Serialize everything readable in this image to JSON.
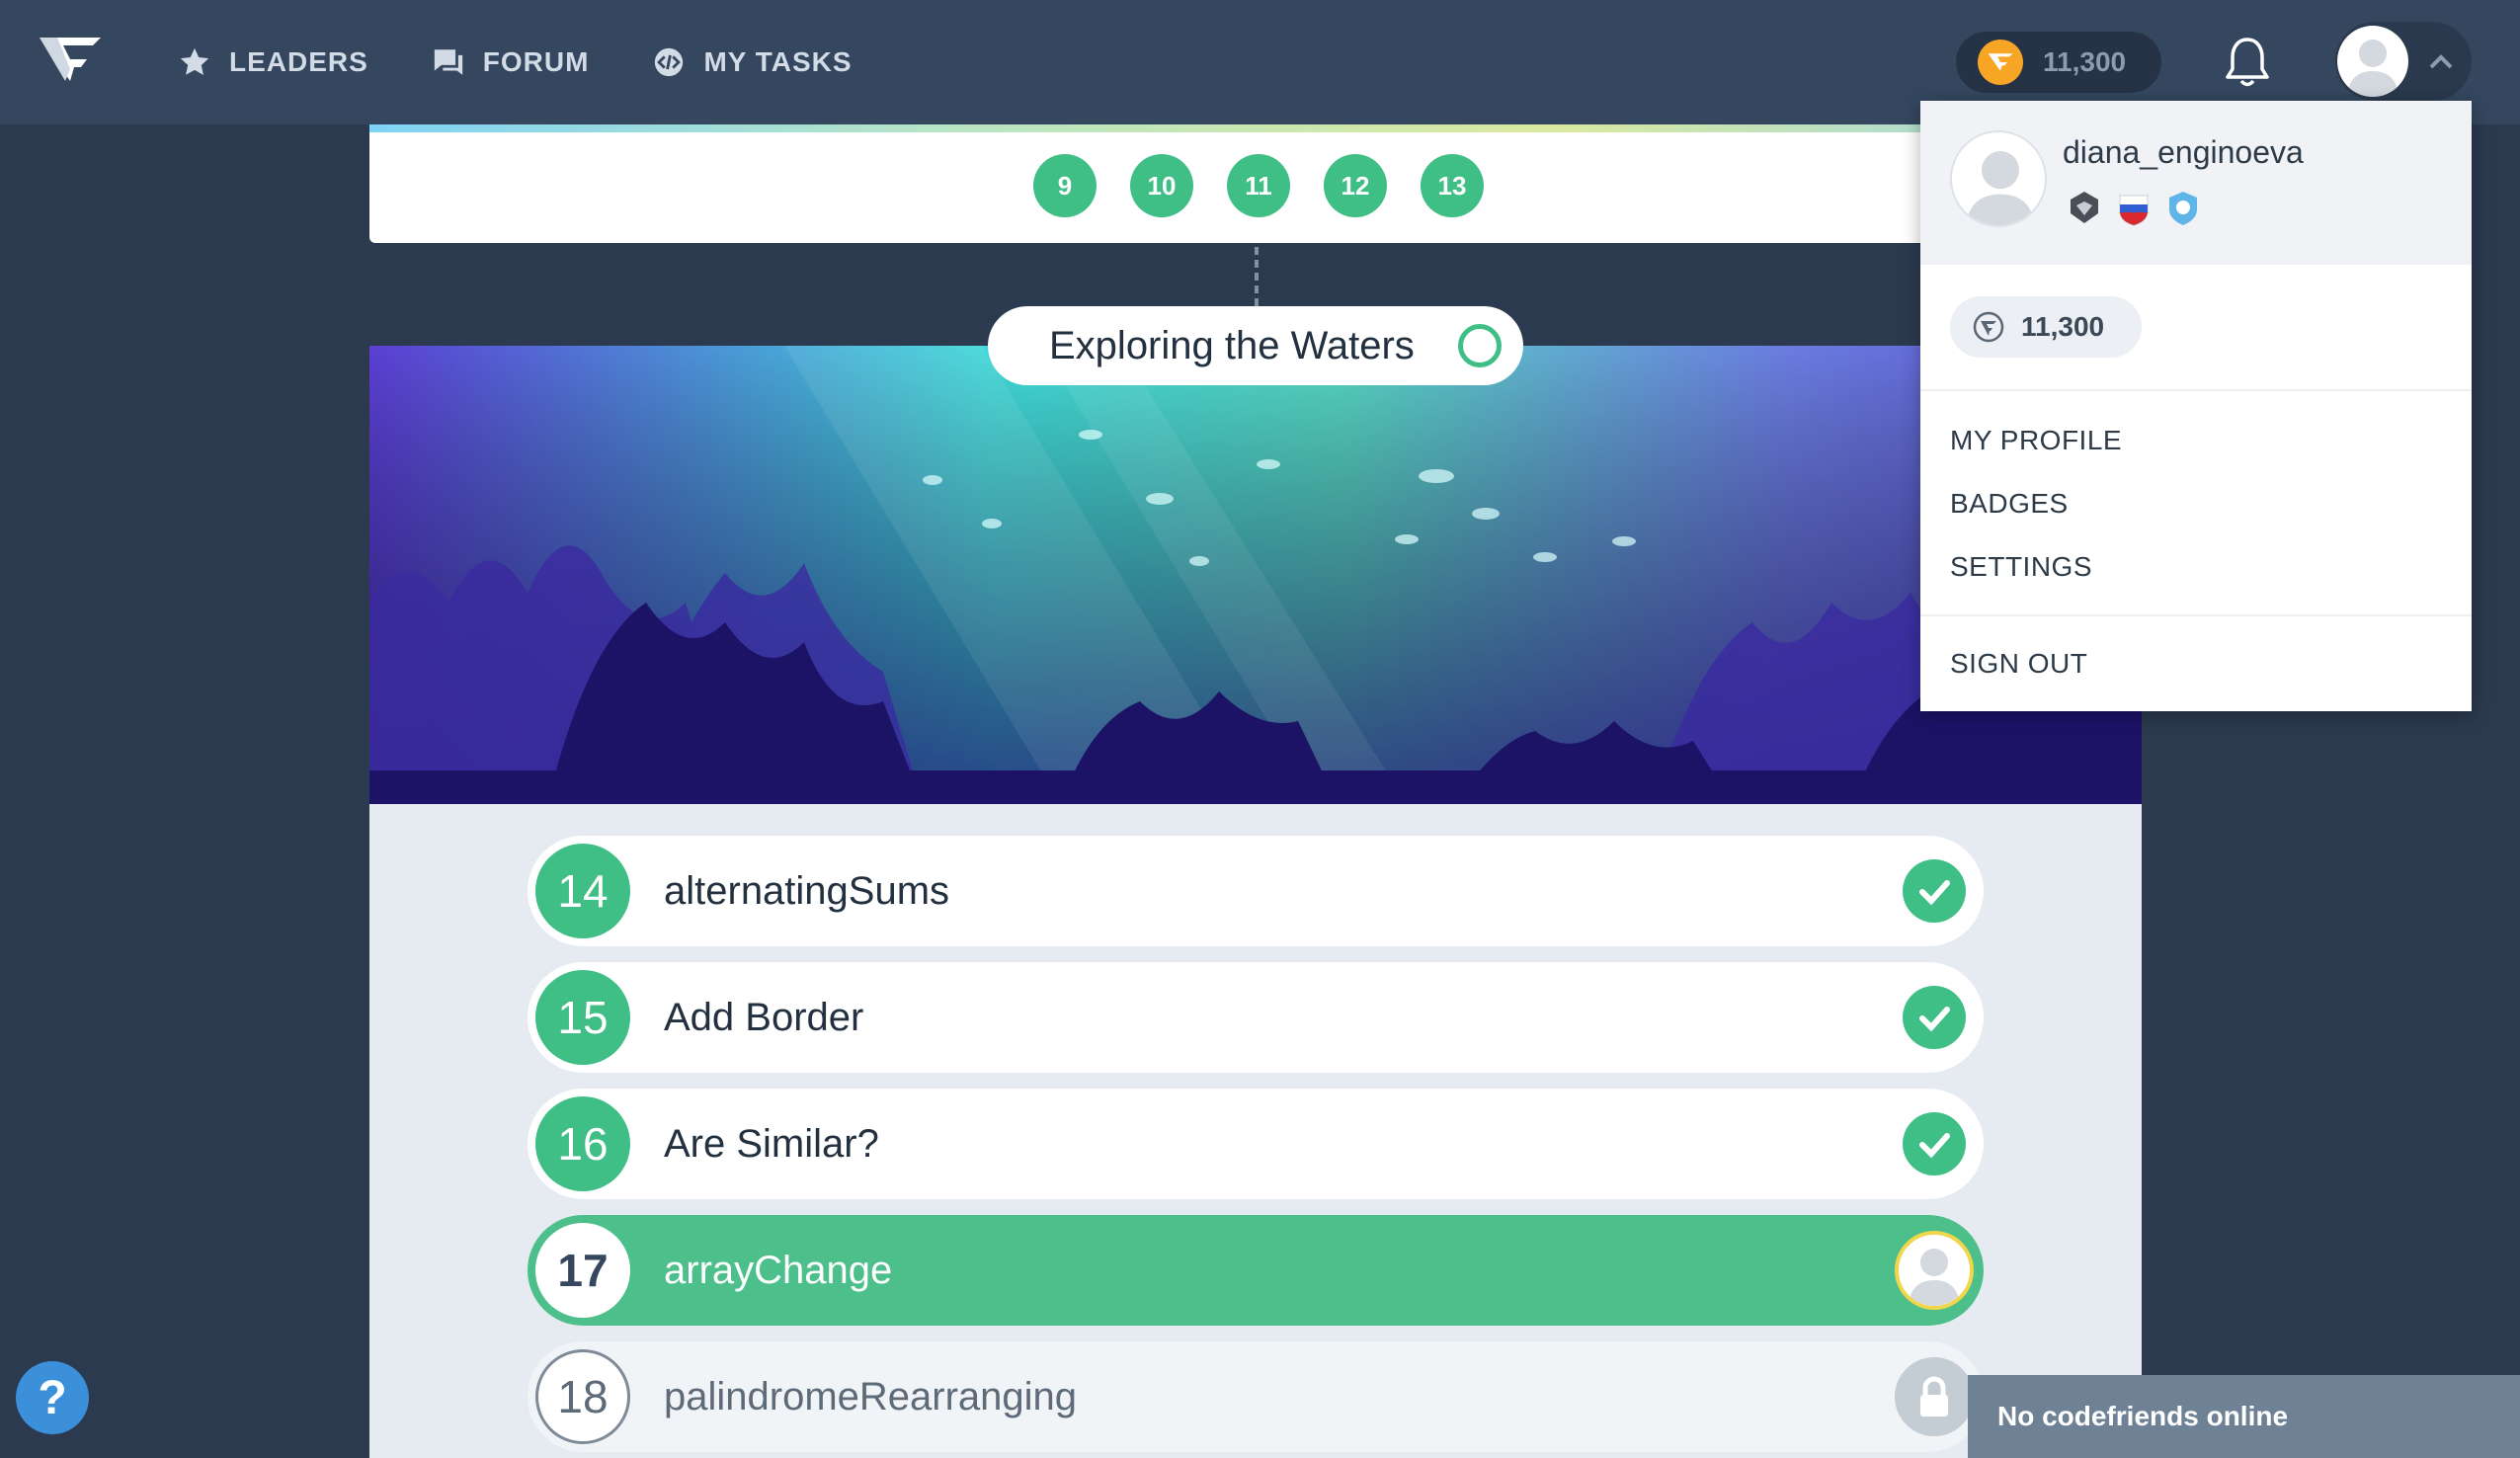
{
  "nav": {
    "items": [
      {
        "label": "LEADERS",
        "icon": "star-icon"
      },
      {
        "label": "FORUM",
        "icon": "forum-icon"
      },
      {
        "label": "MY TASKS",
        "icon": "tasks-icon"
      }
    ],
    "coins": "11,300"
  },
  "levels": [
    "9",
    "10",
    "11",
    "12",
    "13"
  ],
  "chapter": {
    "title": "Exploring the Waters"
  },
  "tasks": [
    {
      "num": "14",
      "title": "alternatingSums",
      "state": "done"
    },
    {
      "num": "15",
      "title": "Add Border",
      "state": "done"
    },
    {
      "num": "16",
      "title": "Are Similar?",
      "state": "done"
    },
    {
      "num": "17",
      "title": "arrayChange",
      "state": "current"
    },
    {
      "num": "18",
      "title": "palindromeRearranging",
      "state": "locked"
    }
  ],
  "dropdown": {
    "username": "diana_enginoeva",
    "coins": "11,300",
    "menu": [
      "MY PROFILE",
      "BADGES",
      "SETTINGS"
    ],
    "signout": "SIGN OUT"
  },
  "help": "?",
  "friends": "No codefriends online",
  "colors": {
    "accent": "#3fbf86",
    "nav": "#34475f",
    "bg": "#2b3a4f",
    "coin": "#f6a624"
  }
}
